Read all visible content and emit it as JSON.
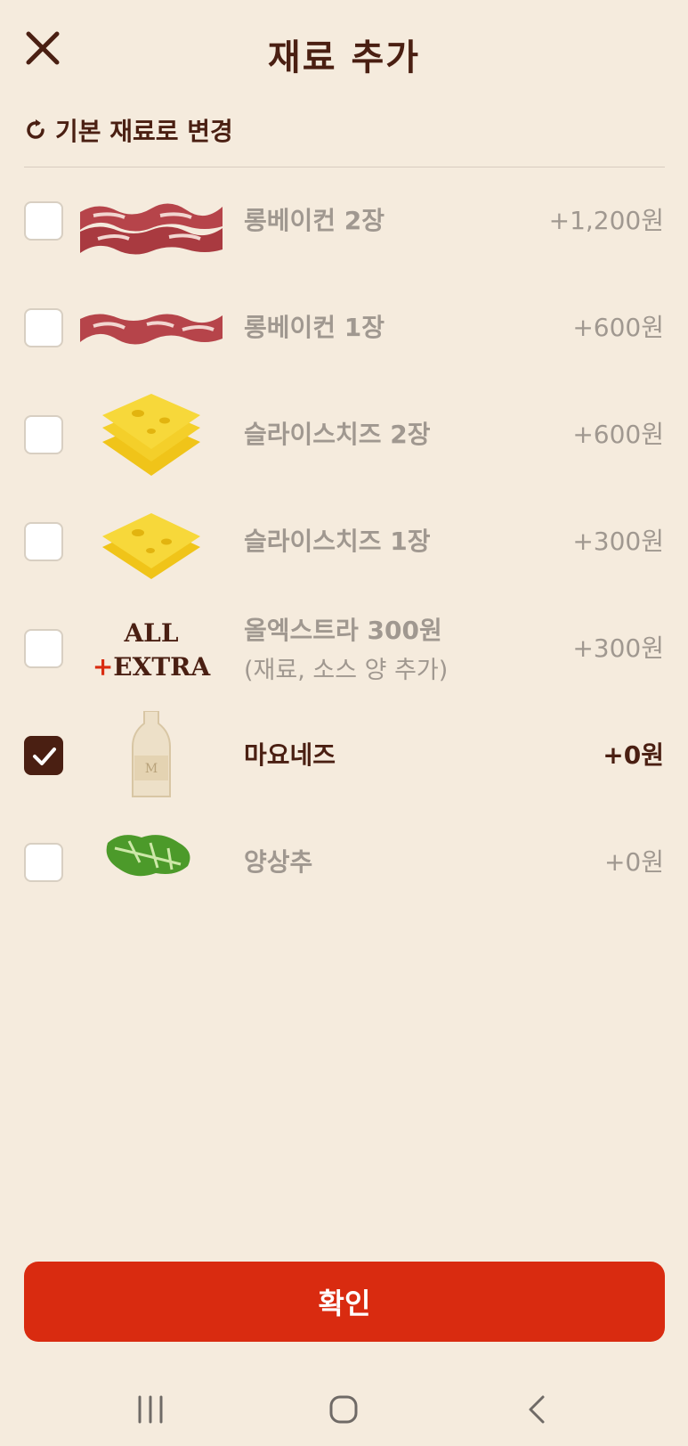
{
  "header": {
    "title": "재료 추가"
  },
  "reset": {
    "label": "기본 재료로 변경"
  },
  "items": [
    {
      "name": "롱베이컨 2장",
      "sub": "",
      "price": "+1,200원",
      "checked": false,
      "icon": "bacon-2-icon"
    },
    {
      "name": "롱베이컨 1장",
      "sub": "",
      "price": "+600원",
      "checked": false,
      "icon": "bacon-1-icon"
    },
    {
      "name": "슬라이스치즈 2장",
      "sub": "",
      "price": "+600원",
      "checked": false,
      "icon": "cheese-2-icon"
    },
    {
      "name": "슬라이스치즈 1장",
      "sub": "",
      "price": "+300원",
      "checked": false,
      "icon": "cheese-1-icon"
    },
    {
      "name": "올엑스트라 300원",
      "sub": "(재료, 소스 양 추가)",
      "price": "+300원",
      "checked": false,
      "icon": "all-extra-logo",
      "logo_line1": "ALL",
      "logo_line2": "+EXTRA"
    },
    {
      "name": "마요네즈",
      "sub": "",
      "price": "+0원",
      "checked": true,
      "icon": "mayonnaise-bottle-icon",
      "bottle_letter": "M"
    },
    {
      "name": "양상추",
      "sub": "",
      "price": "+0원",
      "checked": false,
      "icon": "lettuce-icon"
    }
  ],
  "confirm": {
    "label": "확인"
  },
  "colors": {
    "background": "#f5ebdd",
    "accent": "#d92b10",
    "dark_brown": "#4a1f12",
    "muted_text": "#a09890"
  }
}
